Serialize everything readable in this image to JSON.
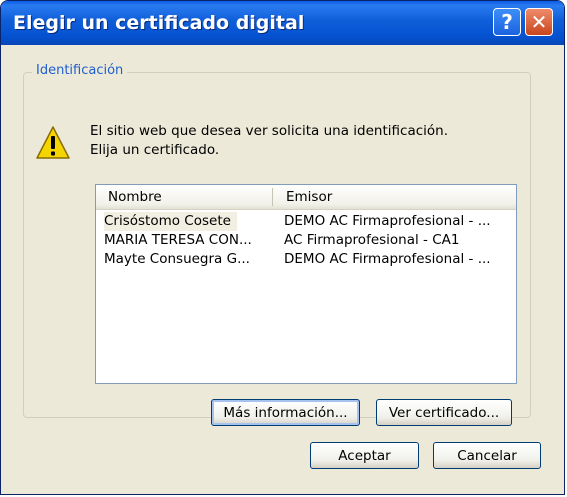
{
  "window": {
    "title": "Elegir un certificado digital",
    "help_label": "?",
    "close_label": "✕"
  },
  "group": {
    "legend": "Identificación",
    "message_line1": "El sitio web que desea ver solicita una identificación.",
    "message_line2": "Elija un certificado."
  },
  "list": {
    "columns": [
      "Nombre",
      "Emisor"
    ],
    "rows": [
      {
        "name": "Crisóstomo Cosete",
        "issuer": "DEMO AC Firmaprofesional - ..."
      },
      {
        "name": "MARIA TERESA CON...",
        "issuer": "AC Firmaprofesional - CA1"
      },
      {
        "name": "Mayte Consuegra G...",
        "issuer": "DEMO AC Firmaprofesional - ..."
      }
    ]
  },
  "buttons": {
    "more_info": "Más información...",
    "view_cert": "Ver certificado...",
    "accept": "Aceptar",
    "cancel": "Cancelar"
  },
  "icons": {
    "warning": "warning-icon",
    "help": "help-icon",
    "close": "close-icon"
  },
  "colors": {
    "title_bar": "#0552d1",
    "dialog_bg": "#ece9d8",
    "legend_text": "#1f5fd0",
    "close_button": "#c8461e",
    "warning": "#f5d500"
  }
}
